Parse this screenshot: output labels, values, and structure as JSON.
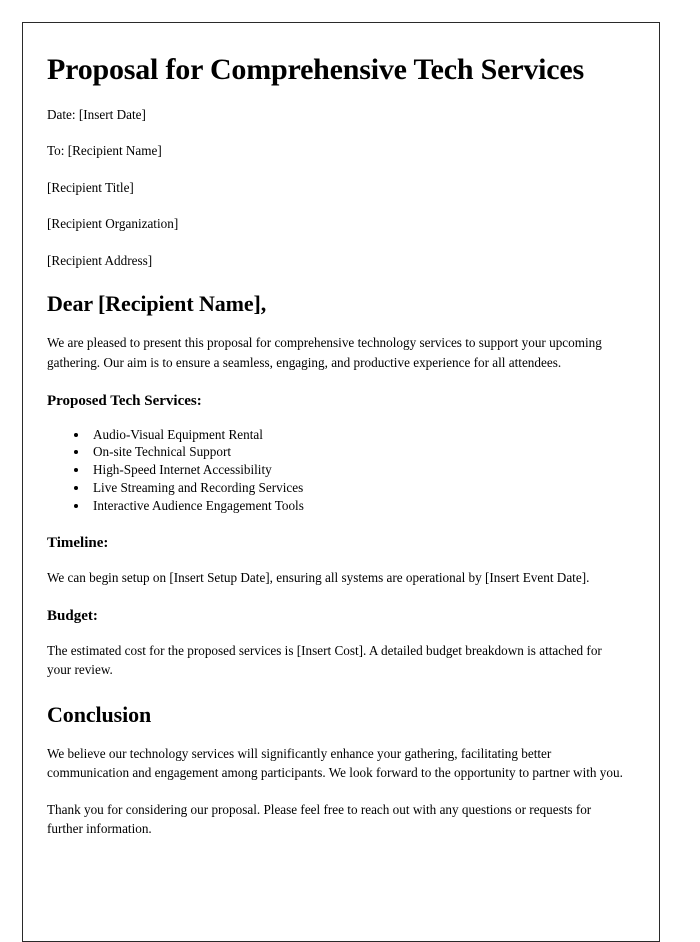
{
  "document": {
    "title": "Proposal for Comprehensive Tech Services",
    "meta": {
      "date_line": "Date: [Insert Date]",
      "to_line": "To: [Recipient Name]",
      "recipient_title": "[Recipient Title]",
      "recipient_organization": "[Recipient Organization]",
      "recipient_address": "[Recipient Address]"
    },
    "salutation": "Dear [Recipient Name],",
    "intro_paragraph": "We are pleased to present this proposal for comprehensive technology services to support your upcoming gathering. Our aim is to ensure a seamless, engaging, and productive experience for all attendees.",
    "services": {
      "heading": "Proposed Tech Services:",
      "items": [
        "Audio-Visual Equipment Rental",
        "On-site Technical Support",
        "High-Speed Internet Accessibility",
        "Live Streaming and Recording Services",
        "Interactive Audience Engagement Tools"
      ]
    },
    "timeline": {
      "heading": "Timeline:",
      "paragraph": "We can begin setup on [Insert Setup Date], ensuring all systems are operational by [Insert Event Date]."
    },
    "budget": {
      "heading": "Budget:",
      "paragraph": "The estimated cost for the proposed services is [Insert Cost]. A detailed budget breakdown is attached for your review."
    },
    "conclusion": {
      "heading": "Conclusion",
      "paragraph": "We believe our technology services will significantly enhance your gathering, facilitating better communication and engagement among participants. We look forward to the opportunity to partner with you.",
      "closing_paragraph": "Thank you for considering our proposal. Please feel free to reach out with any questions or requests for further information."
    }
  }
}
